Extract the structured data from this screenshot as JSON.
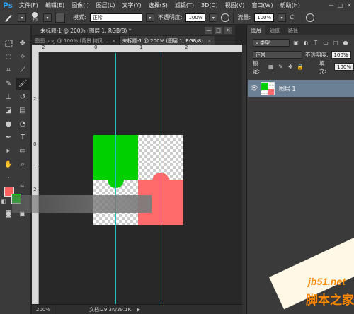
{
  "app": {
    "logo": "Ps"
  },
  "menu": [
    "文件(F)",
    "编辑(E)",
    "图像(I)",
    "图层(L)",
    "文字(Y)",
    "选择(S)",
    "滤镜(T)",
    "3D(D)",
    "视图(V)",
    "窗口(W)",
    "帮助(H)"
  ],
  "window_controls": {
    "minimize": "—",
    "maximize": "□",
    "close": "✕"
  },
  "options": {
    "brush_size": "20",
    "mode_label": "模式:",
    "mode_value": "正常",
    "opacity_label": "不透明度:",
    "opacity_value": "100%",
    "flow_label": "流量:",
    "flow_value": "100%"
  },
  "document": {
    "title": "未标题-1 @ 200% (图层 1, RGB/8) *",
    "tabs": [
      {
        "label": "图图.png @ 100% (背景 拷贝...",
        "close": "×"
      },
      {
        "label": "未标题-1 @ 200% (图层 1, RGB/8)",
        "close": "×"
      }
    ],
    "ruler_h_numbers": [
      "2",
      "0",
      "1",
      "2"
    ],
    "ruler_v_numbers": [
      "2",
      "0",
      "1",
      "2"
    ]
  },
  "status": {
    "zoom": "200%",
    "doc_info": "文档:29.3K/39.1K",
    "arrow": "▶"
  },
  "layers_panel": {
    "tabs": [
      "图层",
      "通道",
      "路径"
    ],
    "filter_label": "类型",
    "blend_mode": "正常",
    "opacity_label": "不透明度:",
    "opacity_value": "100%",
    "lock_label": "锁定:",
    "fill_label": "填充:",
    "fill_value": "100%",
    "layers": [
      {
        "name": "图层 1",
        "visible_icon": "eye-icon"
      }
    ]
  },
  "colors": {
    "foreground": "#ff6060",
    "background": "#00cc00",
    "guide": "#20c0c0"
  },
  "watermark": {
    "line1": "jb51.net",
    "line2": "脚本之家"
  }
}
